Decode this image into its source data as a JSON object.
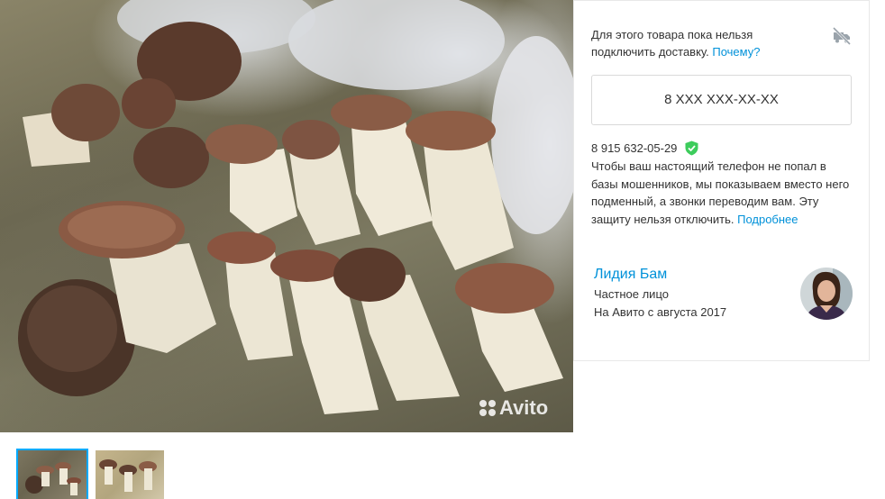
{
  "photo": {
    "watermark": "Avito",
    "description_icon": "photo-of-porcini-mushrooms"
  },
  "thumbnails": [
    {
      "icon": "thumbnail-image",
      "active": true
    },
    {
      "icon": "thumbnail-image",
      "active": false
    }
  ],
  "delivery": {
    "message": "Для этого товара пока нельзя подключить доставку.",
    "why_link": "Почему?",
    "icon": "delivery-disabled-icon"
  },
  "phone": {
    "masked_button": "8 XXX XXX-XX-XX",
    "real_number": "8 915 632-05-29",
    "verified_icon": "shield-check-icon",
    "protection_text": "Чтобы ваш настоящий телефон не попал в базы мошенников, мы показываем вместо него подменный, а звонки переводим вам. Эту защиту нельзя отключить.",
    "more_link": "Подробнее"
  },
  "seller": {
    "name": "Лидия Бам",
    "type": "Частное лицо",
    "since": "На Авито с августа 2017",
    "avatar_icon": "seller-avatar"
  },
  "colors": {
    "link": "#0091d9",
    "accent_green": "#3dcc5c",
    "thumb_active": "#00aaff",
    "text": "#333333"
  }
}
